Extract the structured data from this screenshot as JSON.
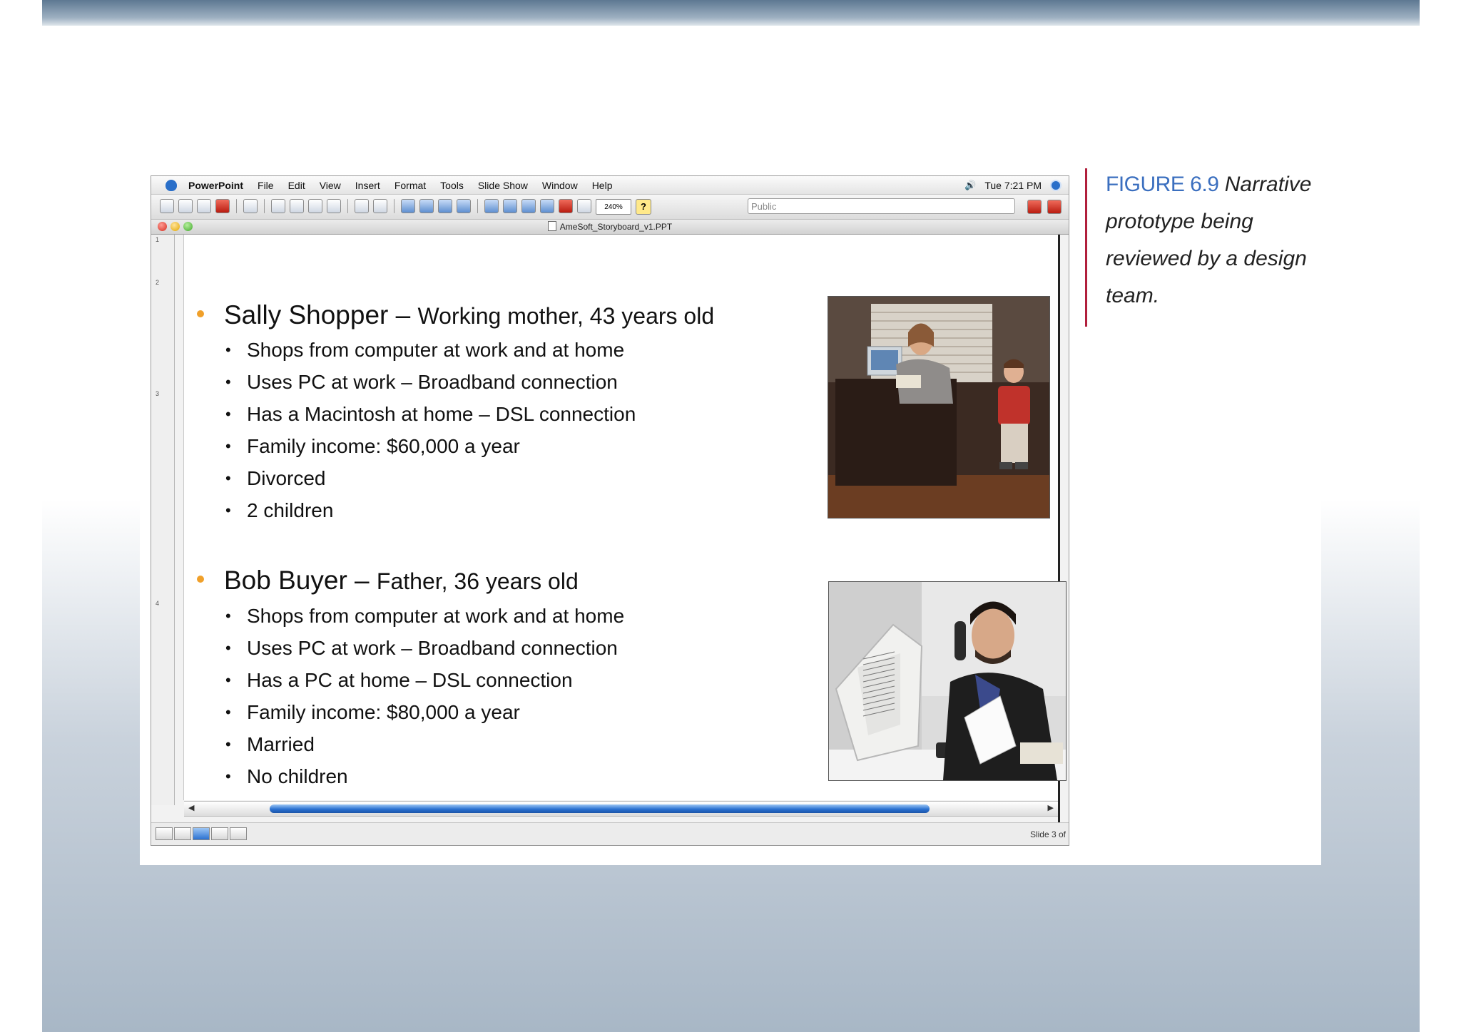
{
  "menubar": {
    "app_name": "PowerPoint",
    "items": [
      "File",
      "Edit",
      "View",
      "Insert",
      "Format",
      "Tools",
      "Slide Show",
      "Window",
      "Help"
    ],
    "clock": "Tue 7:21 PM"
  },
  "toolbar": {
    "zoom": "240%",
    "search_placeholder": "Public"
  },
  "window": {
    "document_title": "AmeSoft_Storyboard_v1.PPT"
  },
  "ruler": {
    "ticks": [
      "1",
      "2",
      "3",
      "4"
    ]
  },
  "slide": {
    "personas": [
      {
        "name": "Sally Shopper",
        "separator": " – ",
        "description": "Working mother, 43 years old",
        "bullets": [
          "Shops from computer at work and at home",
          "Uses PC at work – Broadband connection",
          "Has a Macintosh at home – DSL connection",
          "Family income: $60,000 a year",
          "Divorced",
          "2 children"
        ]
      },
      {
        "name": "Bob Buyer",
        "separator": " – ",
        "description": "Father, 36 years old",
        "bullets": [
          "Shops from computer at work and at home",
          "Uses PC at work – Broadband connection",
          "Has a PC at home – DSL connection",
          "Family income: $80,000 a year",
          "Married",
          "No children"
        ]
      }
    ]
  },
  "status": {
    "slide_count": "Slide 3 of"
  },
  "caption": {
    "label": "FIGURE 6.9",
    "text": "Narrative prototype being reviewed by a design team."
  },
  "colors": {
    "bullet": "#f0a02a",
    "figure_label": "#3b6fbf",
    "caption_rule": "#b11f3c",
    "scroll_thumb": "#2a71d1"
  }
}
